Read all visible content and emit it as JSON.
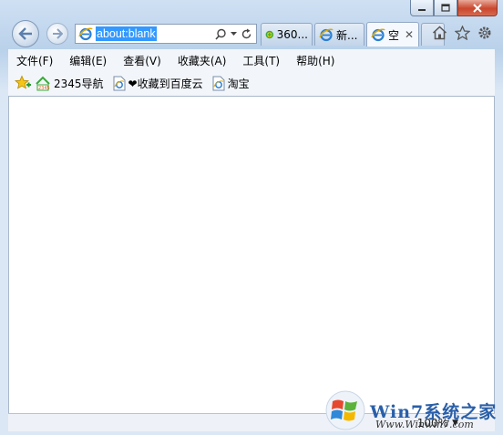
{
  "window": {
    "caption_buttons": [
      "minimize",
      "maximize",
      "close"
    ]
  },
  "address_bar": {
    "value": "about:blank"
  },
  "tabs": [
    {
      "label": "360...",
      "icon": "360-icon",
      "active": false
    },
    {
      "label": "新...",
      "icon": "ie-icon",
      "active": false
    },
    {
      "label": "空",
      "icon": "ie-icon",
      "active": true
    }
  ],
  "menu": {
    "items": [
      "文件(F)",
      "编辑(E)",
      "查看(V)",
      "收藏夹(A)",
      "工具(T)",
      "帮助(H)"
    ]
  },
  "favorites": {
    "items": [
      {
        "label": "2345导航",
        "icon": "2345-icon"
      },
      {
        "label": "❤收藏到百度云",
        "icon": "ie-page-icon"
      },
      {
        "label": "淘宝",
        "icon": "ie-page-icon"
      }
    ]
  },
  "status": {
    "zoom": "100%"
  },
  "watermark": {
    "title": "Win7系统之家",
    "url": "Www.Winwin7.com"
  },
  "colors": {
    "frame": "#b9d1ea",
    "selection": "#3399ff",
    "close_button": "#c9462c"
  }
}
